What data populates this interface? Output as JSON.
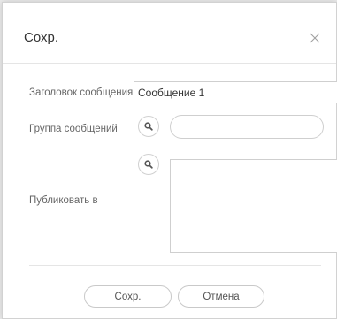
{
  "dialog": {
    "title": "Сохр.",
    "close_icon": "close-icon"
  },
  "form": {
    "subject_label": "Заголовок сообщения",
    "subject_value": "Сообщение 1",
    "group_label": "Группа сообщений",
    "group_value": "",
    "publish_label": "Публиковать в",
    "search_icon": "search-icon"
  },
  "buttons": {
    "save_label": "Сохр.",
    "cancel_label": "Отмена"
  }
}
